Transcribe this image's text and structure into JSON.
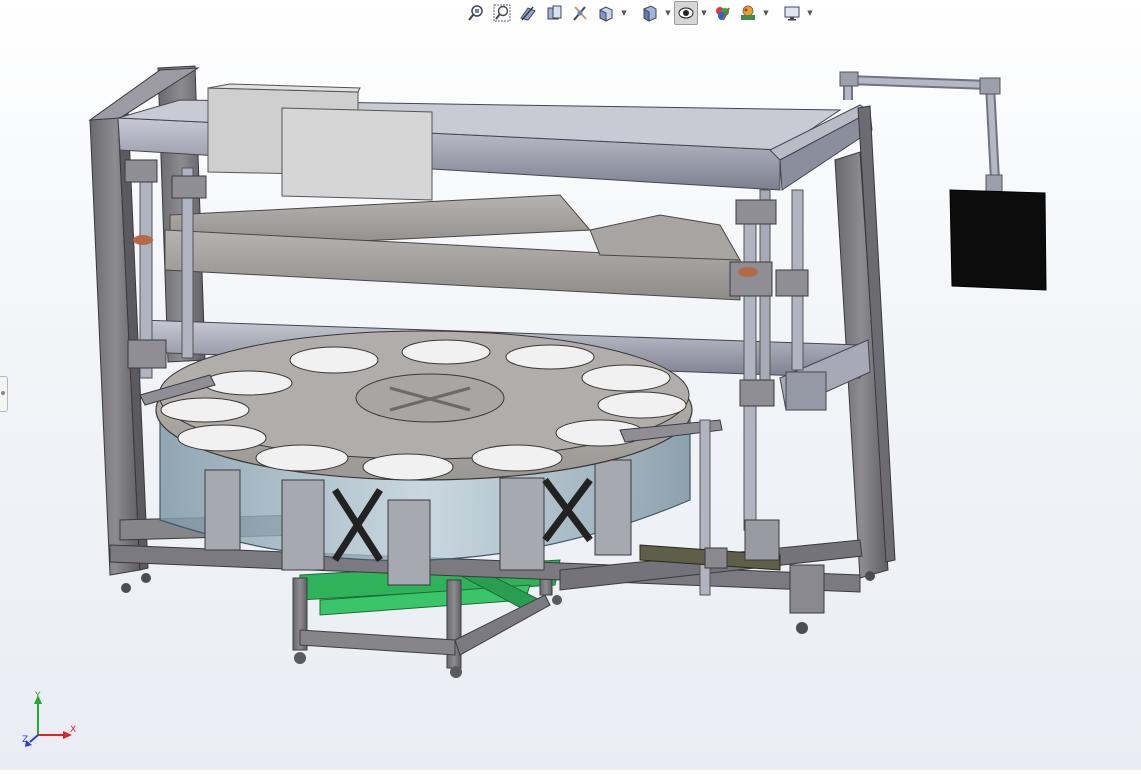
{
  "toolbar": {
    "items": [
      {
        "icon": "zoom-to-fit-icon",
        "has_dropdown": false,
        "active": false
      },
      {
        "icon": "zoom-to-area-icon",
        "has_dropdown": false,
        "active": false
      },
      {
        "icon": "previous-view-icon",
        "has_dropdown": false,
        "active": false
      },
      {
        "icon": "section-view-icon",
        "has_dropdown": false,
        "active": false
      },
      {
        "icon": "dynamic-annotation-icon",
        "has_dropdown": false,
        "active": false
      },
      {
        "icon": "view-orientation-icon",
        "has_dropdown": true,
        "active": false
      },
      {
        "icon": "display-style-icon",
        "has_dropdown": true,
        "active": false
      },
      {
        "icon": "hide-show-items-icon",
        "has_dropdown": true,
        "active": true
      },
      {
        "icon": "edit-appearance-icon",
        "has_dropdown": false,
        "active": false
      },
      {
        "icon": "apply-scene-icon",
        "has_dropdown": true,
        "active": false
      },
      {
        "icon": "view-settings-icon",
        "has_dropdown": true,
        "active": false
      }
    ]
  },
  "triad": {
    "x_label": "X",
    "y_label": "Y",
    "z_label": "Z",
    "colors": {
      "x": "#d8262b",
      "y": "#27a737",
      "z": "#2a3fd6"
    }
  },
  "model": {
    "colors": {
      "frame": "#86858a",
      "frame_dark": "#55545a",
      "frame_light": "#b3b4bc",
      "rail": "#9ca0b0",
      "plate": "#a8a5a2",
      "glass": "#9fb6c4",
      "green_frame": "#2fb35a",
      "black_box": "#0c0c0c",
      "pipe": "#a8acb8"
    }
  }
}
